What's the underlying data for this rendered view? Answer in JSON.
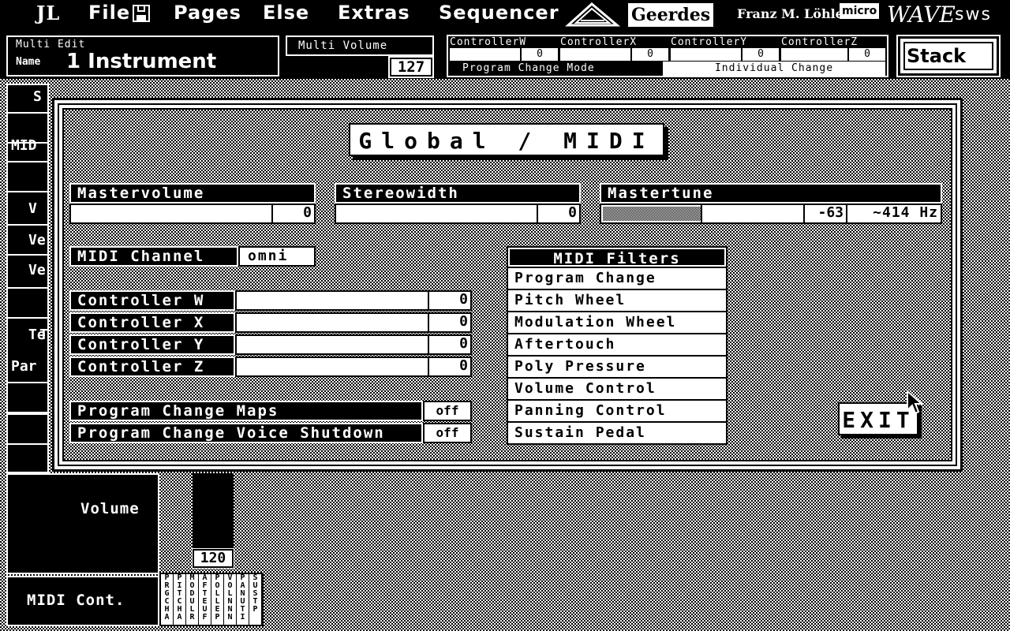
{
  "menubar": {
    "logo": "JL",
    "items": [
      "File",
      "Pages",
      "Else",
      "Extras",
      "Sequencer"
    ],
    "brand": "Geerdes",
    "author": "Franz M. Löhle",
    "micro": "micro",
    "wave": "WAVE",
    "sws": "sws"
  },
  "multi_edit": {
    "title": "Multi Edit",
    "name_label": "Name",
    "name_value": "1 Instrument"
  },
  "multi_volume": {
    "title": "Multi Volume",
    "value": "127"
  },
  "controllers_header": {
    "labels": [
      "ControllerW",
      "ControllerX",
      "ControllerY",
      "ControllerZ"
    ],
    "values": [
      "0",
      "0",
      "0",
      "0"
    ],
    "mode_label": "Program Change Mode",
    "mode_value": "Individual Change"
  },
  "stack_button": "Stack",
  "background": {
    "left_labels": [
      "S",
      "MID",
      "V",
      "Ve",
      "Ve",
      "T",
      "Te",
      "Par"
    ],
    "volume_label": "Volume",
    "volume_value": "120",
    "volume_level": 1.0,
    "midi_cont_label": "MIDI Cont.",
    "filter_cols": [
      "PRGCHA",
      "PITCHA",
      "MODULR",
      "AFTEUF",
      "POLLEP",
      "VOLNNN",
      "PANUTI",
      "SUSTP"
    ]
  },
  "dialog": {
    "title": "Global / MIDI",
    "mastervolume": {
      "label": "Mastervolume",
      "value": "0"
    },
    "stereowidth": {
      "label": "Stereowidth",
      "value": "0"
    },
    "mastertune": {
      "label": "Mastertune",
      "value": "-63",
      "freq": "~414 Hz"
    },
    "midi_channel": {
      "label": "MIDI Channel",
      "value": "omni"
    },
    "controllers": [
      {
        "label": "Controller W",
        "value": "0"
      },
      {
        "label": "Controller X",
        "value": "0"
      },
      {
        "label": "Controller Y",
        "value": "0"
      },
      {
        "label": "Controller Z",
        "value": "0"
      }
    ],
    "program_change_maps": {
      "label": "Program Change Maps",
      "value": "off"
    },
    "program_change_voice_shutdown": {
      "label": "Program Change Voice Shutdown",
      "value": "off"
    },
    "midi_filters": {
      "title": "MIDI Filters",
      "items": [
        "Program Change",
        "Pitch Wheel",
        "Modulation Wheel",
        "Aftertouch",
        "Poly Pressure",
        "Volume Control",
        "Panning Control",
        "Sustain Pedal"
      ]
    },
    "exit_label": "EXIT"
  }
}
